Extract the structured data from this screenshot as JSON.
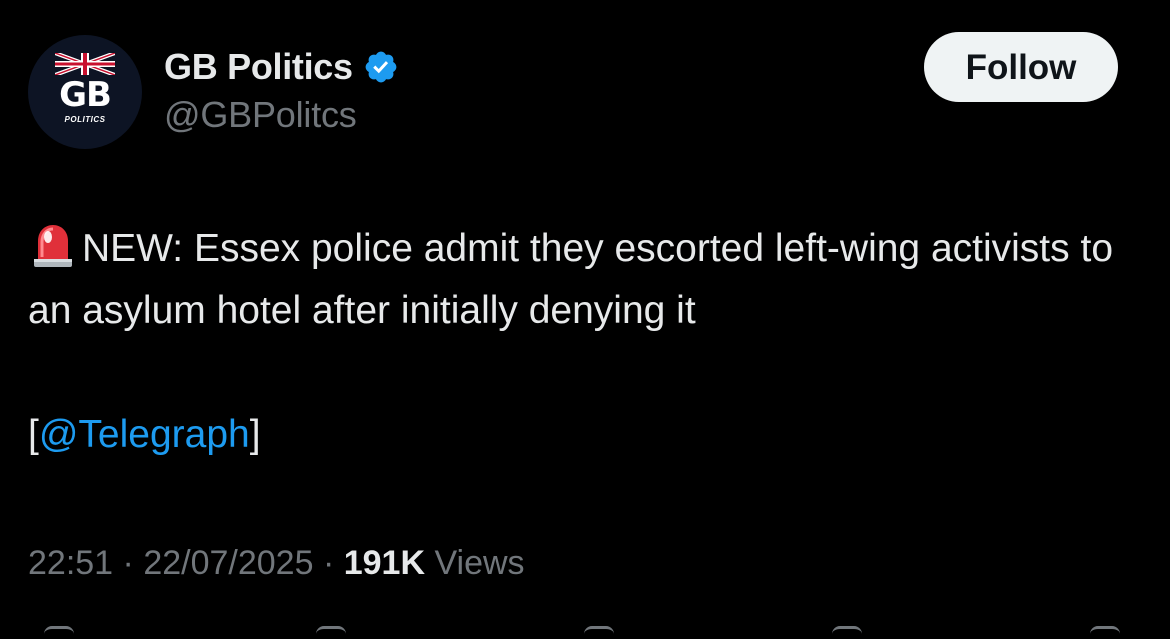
{
  "author": {
    "display_name": "GB Politics",
    "handle": "@GBPolitcs",
    "verified": true,
    "avatar": {
      "logo_text": "GB",
      "logo_subtext": "POLITICS"
    }
  },
  "follow_button": {
    "label": "Follow"
  },
  "tweet": {
    "emoji": "siren-icon",
    "text": "NEW: Essex police admit they escorted left-wing activists to an asylum hotel after initially denying it",
    "mention_open": "[",
    "mention": "@Telegraph",
    "mention_close": "]"
  },
  "meta": {
    "time": "22:51",
    "separator": "·",
    "date": "22/07/2025",
    "views_count": "191K",
    "views_label": "Views"
  },
  "colors": {
    "background": "#000000",
    "text": "#e7e9ea",
    "secondary": "#71767b",
    "link": "#1d9bf0",
    "verified": "#1d9bf0",
    "follow_bg": "#eff3f4"
  }
}
